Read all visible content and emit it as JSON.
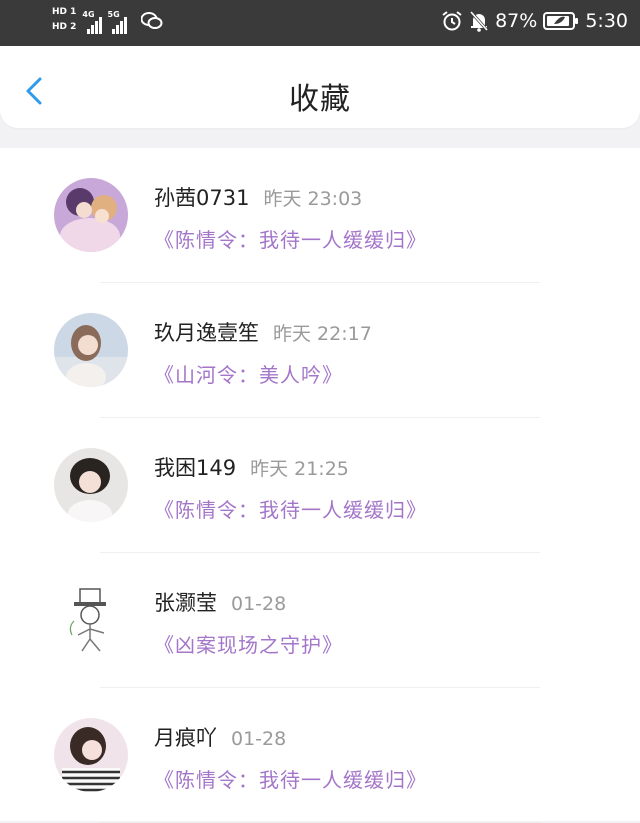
{
  "status_bar": {
    "hd1": "HD 1",
    "hd2": "HD 2",
    "net1": "4G",
    "net2": "5G",
    "battery": "87%",
    "time": "5:30"
  },
  "header": {
    "title": "收藏"
  },
  "favorites": [
    {
      "name": "孙茜0731",
      "time": "昨天 23:03",
      "work": "《陈情令：我待一人缓缓归》"
    },
    {
      "name": "玖月逸壹笙",
      "time": "昨天 22:17",
      "work": "《山河令：美人吟》"
    },
    {
      "name": "我困149",
      "time": "昨天 21:25",
      "work": "《陈情令：我待一人缓缓归》"
    },
    {
      "name": "张灏莹",
      "time": "01-28",
      "work": "《凶案现场之守护》"
    },
    {
      "name": "月痕吖",
      "time": "01-28",
      "work": "《陈情令：我待一人缓缓归》"
    }
  ]
}
